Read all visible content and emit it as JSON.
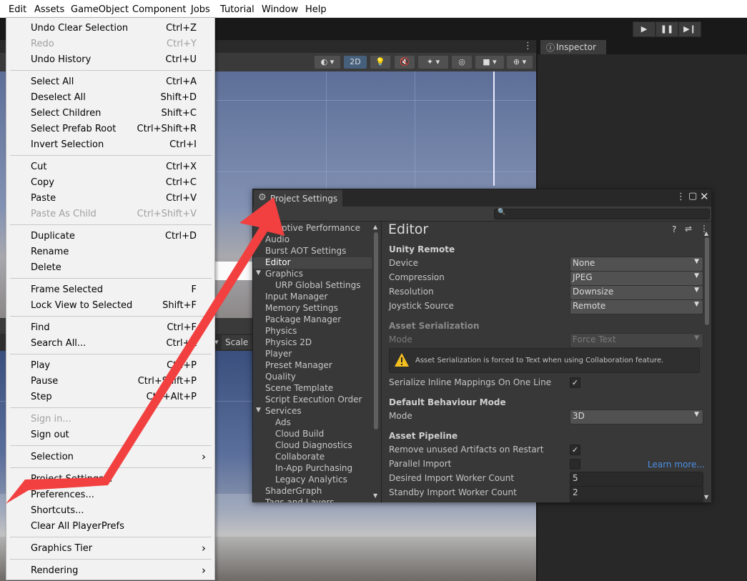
{
  "menubar": {
    "items": [
      "Edit",
      "Assets",
      "GameObject",
      "Component",
      "Jobs",
      "Tutorial",
      "Window",
      "Help"
    ]
  },
  "toolbar": {
    "play_icon": "play-icon",
    "pause_icon": "pause-icon",
    "step_icon": "step-icon"
  },
  "scene": {
    "mode_2d": "2D"
  },
  "game": {
    "scale_label": "Scale"
  },
  "inspector": {
    "tab_label": "Inspector"
  },
  "edit_menu": {
    "groups": [
      [
        {
          "label": "Undo Clear Selection",
          "shortcut": "Ctrl+Z"
        },
        {
          "label": "Redo",
          "shortcut": "Ctrl+Y",
          "disabled": true
        },
        {
          "label": "Undo History",
          "shortcut": "Ctrl+U"
        }
      ],
      [
        {
          "label": "Select All",
          "shortcut": "Ctrl+A"
        },
        {
          "label": "Deselect All",
          "shortcut": "Shift+D"
        },
        {
          "label": "Select Children",
          "shortcut": "Shift+C"
        },
        {
          "label": "Select Prefab Root",
          "shortcut": "Ctrl+Shift+R"
        },
        {
          "label": "Invert Selection",
          "shortcut": "Ctrl+I"
        }
      ],
      [
        {
          "label": "Cut",
          "shortcut": "Ctrl+X"
        },
        {
          "label": "Copy",
          "shortcut": "Ctrl+C"
        },
        {
          "label": "Paste",
          "shortcut": "Ctrl+V"
        },
        {
          "label": "Paste As Child",
          "shortcut": "Ctrl+Shift+V",
          "disabled": true
        }
      ],
      [
        {
          "label": "Duplicate",
          "shortcut": "Ctrl+D"
        },
        {
          "label": "Rename",
          "shortcut": ""
        },
        {
          "label": "Delete",
          "shortcut": ""
        }
      ],
      [
        {
          "label": "Frame Selected",
          "shortcut": "F"
        },
        {
          "label": "Lock View to Selected",
          "shortcut": "Shift+F"
        }
      ],
      [
        {
          "label": "Find",
          "shortcut": "Ctrl+F"
        },
        {
          "label": "Search All...",
          "shortcut": "Ctrl+K"
        }
      ],
      [
        {
          "label": "Play",
          "shortcut": "Ctrl+P"
        },
        {
          "label": "Pause",
          "shortcut": "Ctrl+Shift+P"
        },
        {
          "label": "Step",
          "shortcut": "Ctrl+Alt+P"
        }
      ],
      [
        {
          "label": "Sign in...",
          "shortcut": "",
          "disabled": true
        },
        {
          "label": "Sign out",
          "shortcut": ""
        }
      ],
      [
        {
          "label": "Selection",
          "shortcut": "",
          "submenu": true
        }
      ],
      [
        {
          "label": "Project Settings...",
          "shortcut": ""
        },
        {
          "label": "Preferences...",
          "shortcut": ""
        },
        {
          "label": "Shortcuts...",
          "shortcut": ""
        },
        {
          "label": "Clear All PlayerPrefs",
          "shortcut": ""
        }
      ],
      [
        {
          "label": "Graphics Tier",
          "shortcut": "",
          "submenu": true
        }
      ],
      [
        {
          "label": "Rendering",
          "shortcut": "",
          "submenu": true
        }
      ]
    ]
  },
  "project_settings": {
    "title": "Project Settings",
    "nav": [
      {
        "label": "Adaptive Performance",
        "indent": 0
      },
      {
        "label": "Audio",
        "indent": 0
      },
      {
        "label": "Burst AOT Settings",
        "indent": 0
      },
      {
        "label": "Editor",
        "indent": 0,
        "selected": true
      },
      {
        "label": "Graphics",
        "indent": 0,
        "expanded": true
      },
      {
        "label": "URP Global Settings",
        "indent": 1
      },
      {
        "label": "Input Manager",
        "indent": 0
      },
      {
        "label": "Memory Settings",
        "indent": 0
      },
      {
        "label": "Package Manager",
        "indent": 0
      },
      {
        "label": "Physics",
        "indent": 0
      },
      {
        "label": "Physics 2D",
        "indent": 0
      },
      {
        "label": "Player",
        "indent": 0
      },
      {
        "label": "Preset Manager",
        "indent": 0
      },
      {
        "label": "Quality",
        "indent": 0
      },
      {
        "label": "Scene Template",
        "indent": 0
      },
      {
        "label": "Script Execution Order",
        "indent": 0
      },
      {
        "label": "Services",
        "indent": 0,
        "expanded": true
      },
      {
        "label": "Ads",
        "indent": 1
      },
      {
        "label": "Cloud Build",
        "indent": 1
      },
      {
        "label": "Cloud Diagnostics",
        "indent": 1
      },
      {
        "label": "Collaborate",
        "indent": 1
      },
      {
        "label": "In-App Purchasing",
        "indent": 1
      },
      {
        "label": "Legacy Analytics",
        "indent": 1
      },
      {
        "label": "ShaderGraph",
        "indent": 0
      },
      {
        "label": "Tags and Layers",
        "indent": 0
      }
    ],
    "editor": {
      "title": "Editor",
      "unity_remote": {
        "header": "Unity Remote",
        "device_label": "Device",
        "device_value": "None",
        "compression_label": "Compression",
        "compression_value": "JPEG",
        "resolution_label": "Resolution",
        "resolution_value": "Downsize",
        "joystick_label": "Joystick Source",
        "joystick_value": "Remote"
      },
      "asset_serialization": {
        "header": "Asset Serialization",
        "mode_label": "Mode",
        "mode_value": "Force Text",
        "warning": "Asset Serialization is forced to Text when using Collaboration feature.",
        "inline_label": "Serialize Inline Mappings On One Line",
        "inline_checked": true
      },
      "default_behaviour": {
        "header": "Default Behaviour Mode",
        "mode_label": "Mode",
        "mode_value": "3D"
      },
      "asset_pipeline": {
        "header": "Asset Pipeline",
        "remove_label": "Remove unused Artifacts on Restart",
        "remove_checked": true,
        "parallel_label": "Parallel Import",
        "parallel_checked": false,
        "learn_more": "Learn more...",
        "desired_label": "Desired Import Worker Count",
        "desired_value": "5",
        "standby_label": "Standby Import Worker Count",
        "standby_value": "2"
      }
    }
  },
  "colors": {
    "arrow": "#f24040",
    "link": "#4c8fe8",
    "warning": "#f4c020"
  }
}
